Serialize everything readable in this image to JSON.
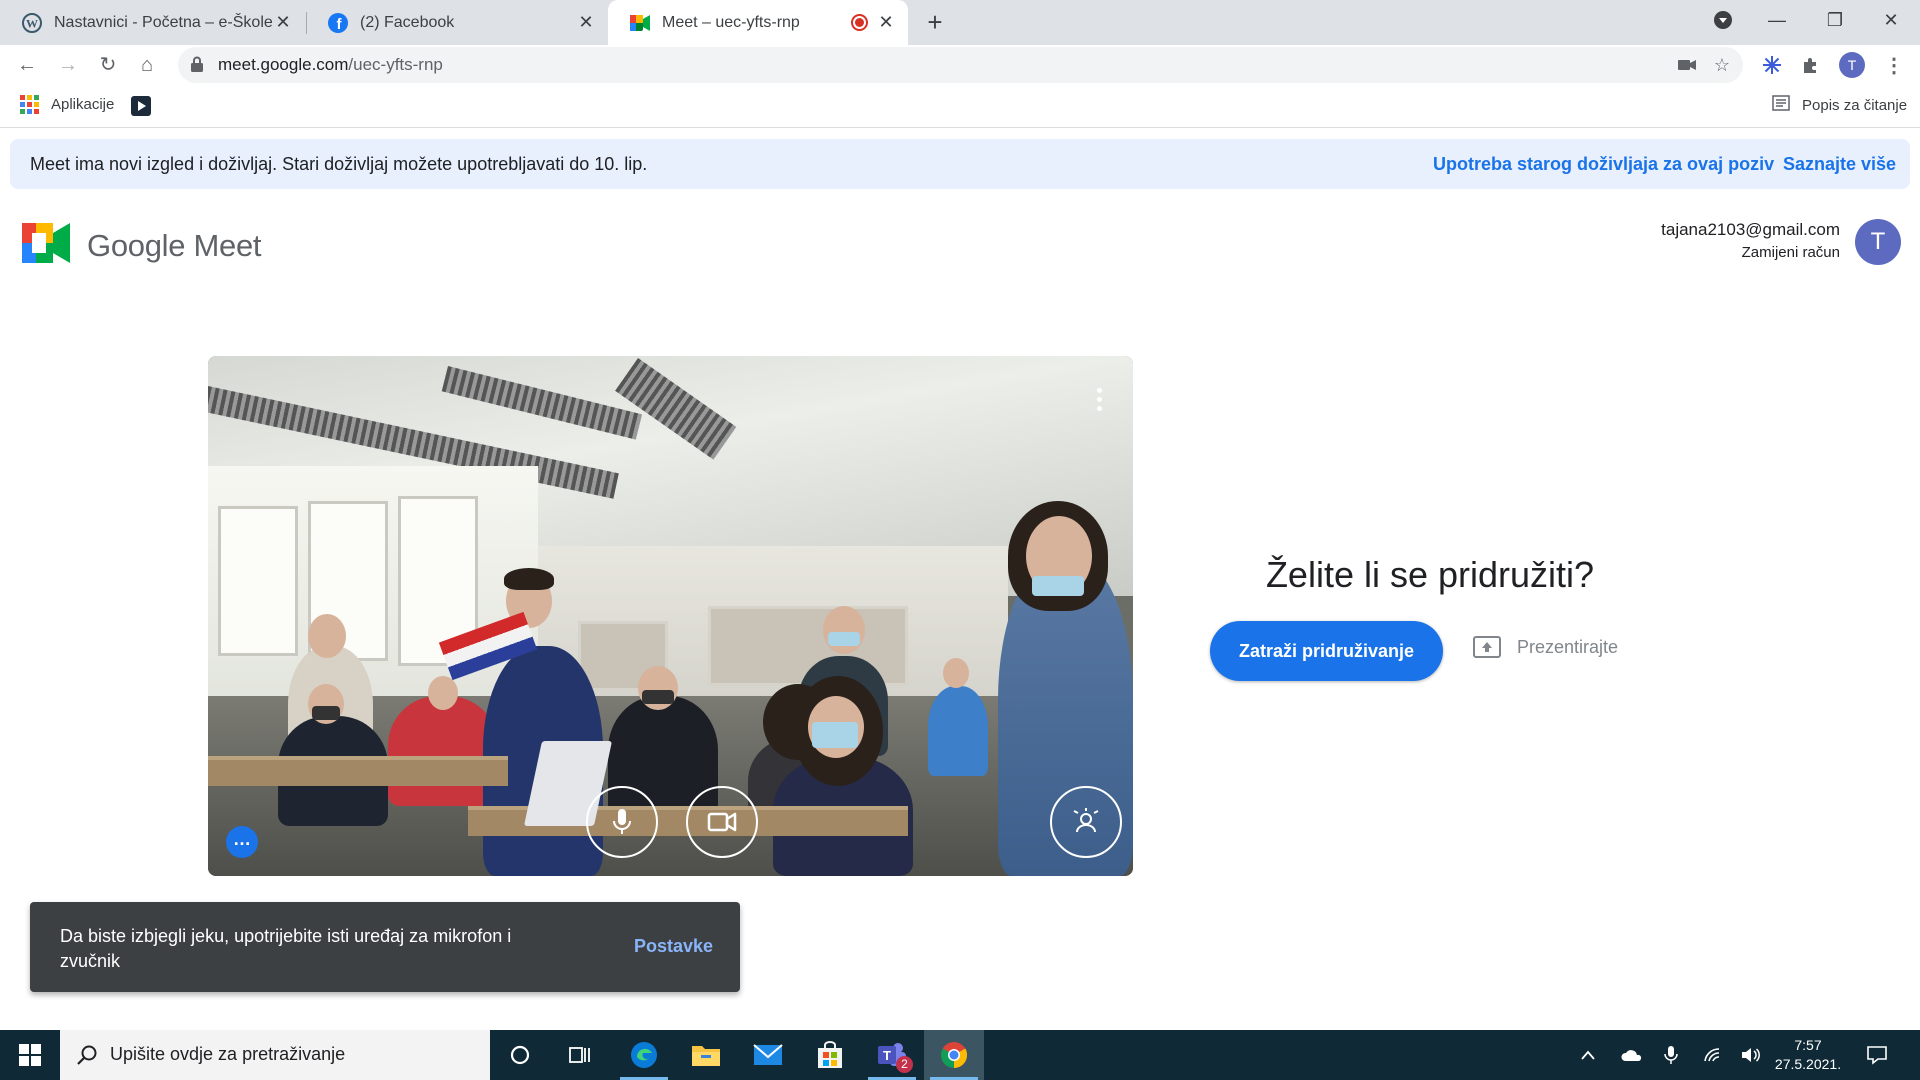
{
  "browser": {
    "tabs": [
      {
        "title": "Nastavnici - Početna – e-Škole",
        "icon": "wordpress-icon"
      },
      {
        "title": "(2) Facebook",
        "icon": "facebook-icon"
      },
      {
        "title": "Meet – uec-yfts-rnp",
        "icon": "google-meet-icon",
        "active": true,
        "recording": true
      }
    ],
    "url_host": "meet.google.com",
    "url_path": "/uec-yfts-rnp",
    "profile_initial": "T",
    "bookmarks": {
      "apps_label": "Aplikacije",
      "reading_list_label": "Popis za čitanje"
    }
  },
  "banner": {
    "message": "Meet ima novi izgled i doživljaj. Stari doživljaj možete upotrebljavati do 10. lip.",
    "link_old": "Upotreba starog doživljaja za ovaj poziv",
    "link_more": "Saznajte više"
  },
  "header": {
    "logo_text": "Google Meet",
    "account_email": "tajana2103@gmail.com",
    "switch_account": "Zamijeni račun",
    "avatar_initial": "T"
  },
  "join": {
    "title": "Želite li se pridružiti?",
    "join_button": "Zatraži pridruživanje",
    "present_button": "Prezentirajte"
  },
  "toast": {
    "message": "Da biste izbjegli jeku, upotrijebite isti uređaj za mikrofon i zvučnik",
    "action": "Postavke"
  },
  "taskbar": {
    "search_placeholder": "Upišite ovdje za pretraživanje",
    "teams_badge": "2",
    "time": "7:57",
    "date": "27.5.2021."
  },
  "colors": {
    "accent": "#1a73e8",
    "banner_bg": "#e8f0fe",
    "toast_bg": "#3c4043",
    "taskbar_bg": "#0f2a36"
  }
}
